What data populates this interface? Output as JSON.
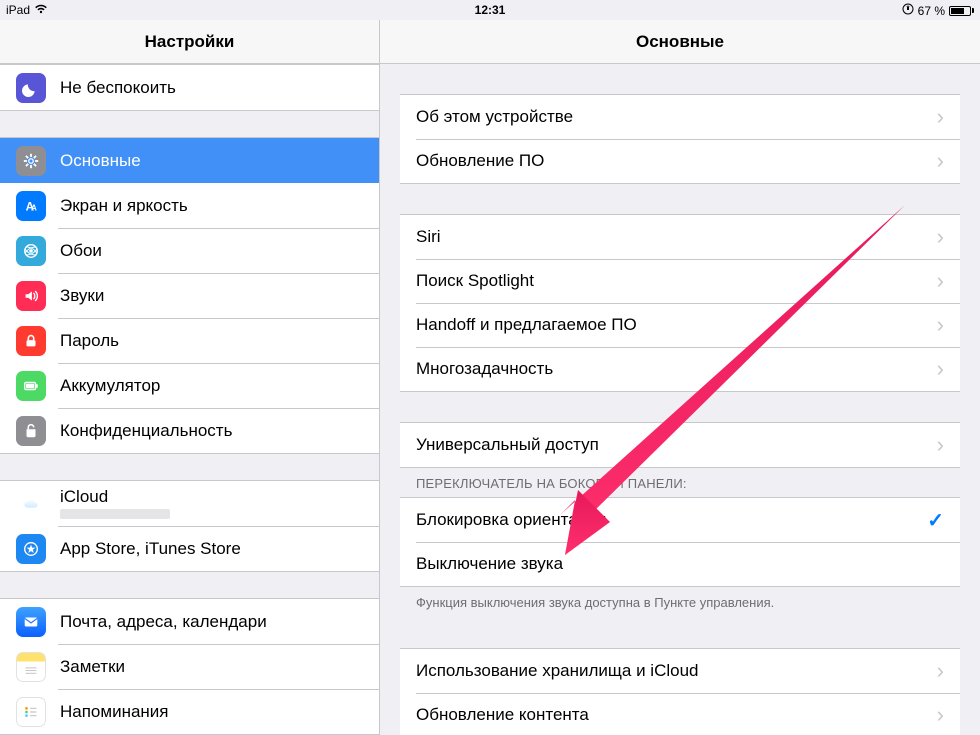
{
  "statusbar": {
    "device": "iPad",
    "time": "12:31",
    "battery_pct": "67 %"
  },
  "sidebar": {
    "title": "Настройки",
    "groups": [
      {
        "items": [
          {
            "key": "dnd",
            "icon": "moon-icon",
            "label": "Не беспокоить"
          }
        ]
      },
      {
        "items": [
          {
            "key": "general",
            "icon": "gear-icon",
            "label": "Основные",
            "selected": true
          },
          {
            "key": "display",
            "icon": "display-icon",
            "label": "Экран и яркость"
          },
          {
            "key": "wallpaper",
            "icon": "wallpaper-icon",
            "label": "Обои"
          },
          {
            "key": "sounds",
            "icon": "sound-icon",
            "label": "Звуки"
          },
          {
            "key": "passcode",
            "icon": "lock-icon",
            "label": "Пароль"
          },
          {
            "key": "battery",
            "icon": "battery-icon",
            "label": "Аккумулятор"
          },
          {
            "key": "privacy",
            "icon": "privacy-icon",
            "label": "Конфиденциальность"
          }
        ]
      },
      {
        "items": [
          {
            "key": "icloud",
            "icon": "cloud-icon",
            "label": "iCloud",
            "sub": ""
          },
          {
            "key": "appstore",
            "icon": "appstore-icon",
            "label": "App Store, iTunes Store"
          }
        ]
      },
      {
        "items": [
          {
            "key": "mail",
            "icon": "mail-icon",
            "label": "Почта, адреса, календари"
          },
          {
            "key": "notes",
            "icon": "notes-icon",
            "label": "Заметки"
          },
          {
            "key": "reminders",
            "icon": "reminders-icon",
            "label": "Напоминания"
          }
        ]
      }
    ]
  },
  "detail": {
    "title": "Основные",
    "side_switch_header": "ПЕРЕКЛЮЧАТЕЛЬ НА БОКОВОЙ ПАНЕЛИ:",
    "side_switch_footer": "Функция выключения звука доступна в Пункте управления.",
    "groups": [
      {
        "rows": [
          {
            "key": "about",
            "label": "Об этом устройстве",
            "accessory": "chevron"
          },
          {
            "key": "software_update",
            "label": "Обновление ПО",
            "accessory": "chevron"
          }
        ]
      },
      {
        "rows": [
          {
            "key": "siri",
            "label": "Siri",
            "accessory": "chevron"
          },
          {
            "key": "spotlight",
            "label": "Поиск Spotlight",
            "accessory": "chevron"
          },
          {
            "key": "handoff",
            "label": "Handoff и предлагаемое ПО",
            "accessory": "chevron"
          },
          {
            "key": "multitasking",
            "label": "Многозадачность",
            "accessory": "chevron"
          }
        ]
      },
      {
        "rows": [
          {
            "key": "accessibility",
            "label": "Универсальный доступ",
            "accessory": "chevron"
          }
        ]
      },
      {
        "header": true,
        "footer": true,
        "rows": [
          {
            "key": "lock_rotation",
            "label": "Блокировка ориентации",
            "accessory": "check"
          },
          {
            "key": "mute",
            "label": "Выключение звука",
            "accessory": "none"
          }
        ]
      },
      {
        "rows": [
          {
            "key": "storage",
            "label": "Использование хранилища и iCloud",
            "accessory": "chevron"
          },
          {
            "key": "background_refresh",
            "label": "Обновление контента",
            "accessory": "chevron"
          }
        ]
      }
    ]
  }
}
